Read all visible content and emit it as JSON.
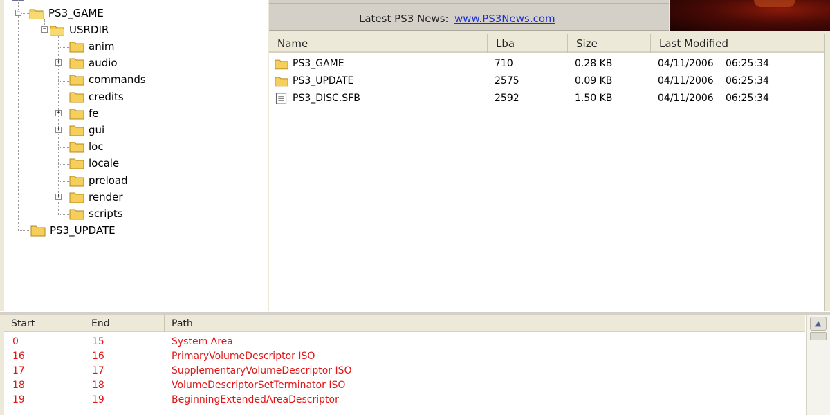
{
  "tree": {
    "root_label": "PS3_GAME",
    "usrdir_label": "USRDIR",
    "children": [
      {
        "label": "anim",
        "expandable": false
      },
      {
        "label": "audio",
        "expandable": true
      },
      {
        "label": "commands",
        "expandable": false
      },
      {
        "label": "credits",
        "expandable": false
      },
      {
        "label": "fe",
        "expandable": true
      },
      {
        "label": "gui",
        "expandable": true
      },
      {
        "label": "loc",
        "expandable": false
      },
      {
        "label": "locale",
        "expandable": false
      },
      {
        "label": "preload",
        "expandable": false
      },
      {
        "label": "render",
        "expandable": true
      },
      {
        "label": "scripts",
        "expandable": false
      }
    ],
    "update_label": "PS3_UPDATE",
    "expand_glyph": "+",
    "collapse_glyph": "−"
  },
  "news": {
    "label": "Latest PS3 News:",
    "link_text": "www.PS3News.com"
  },
  "file_list": {
    "columns": [
      "Name",
      "Lba",
      "Size",
      "Last Modified"
    ],
    "rows": [
      {
        "icon": "folder-icon",
        "name": "PS3_GAME",
        "lba": "710",
        "size": "0.28 KB",
        "date": "04/11/2006",
        "time": "06:25:34"
      },
      {
        "icon": "folder-icon",
        "name": "PS3_UPDATE",
        "lba": "2575",
        "size": "0.09 KB",
        "date": "04/11/2006",
        "time": "06:25:34"
      },
      {
        "icon": "file-icon",
        "name": "PS3_DISC.SFB",
        "lba": "2592",
        "size": "1.50 KB",
        "date": "04/11/2006",
        "time": "06:25:34"
      }
    ]
  },
  "log": {
    "columns": [
      "Start",
      "End",
      "Path"
    ],
    "rows": [
      {
        "start": "0",
        "end": "15",
        "path": "System Area"
      },
      {
        "start": "16",
        "end": "16",
        "path": "PrimaryVolumeDescriptor ISO"
      },
      {
        "start": "17",
        "end": "17",
        "path": "SupplementaryVolumeDescriptor ISO"
      },
      {
        "start": "18",
        "end": "18",
        "path": "VolumeDescriptorSetTerminator ISO"
      },
      {
        "start": "19",
        "end": "19",
        "path": "BeginningExtendedAreaDescriptor"
      }
    ],
    "row_color": "#e01616"
  },
  "scrollbar": {
    "up_arrow_glyph": "▲"
  },
  "colors": {
    "link": "#1c2fd6",
    "log_text": "#e01616",
    "window_bg": "#ece9d8"
  }
}
